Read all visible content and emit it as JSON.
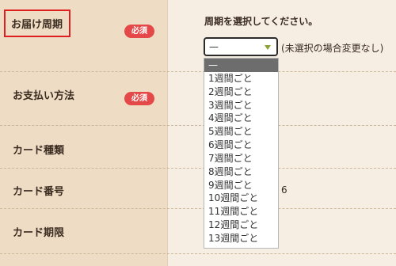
{
  "form": {
    "rows": [
      {
        "label": "お届け周期",
        "required": "必須"
      },
      {
        "label": "お支払い方法",
        "required": "必須"
      },
      {
        "label": "カード種類"
      },
      {
        "label": "カード番号"
      },
      {
        "label": "カード期限"
      }
    ],
    "cycle": {
      "prompt": "周期を選択してください。",
      "selected": "—",
      "note": "(未選択の場合変更なし)",
      "options": [
        "—",
        "1週間ごと",
        "2週間ごと",
        "3週間ごと",
        "4週間ごと",
        "5週間ごと",
        "6週間ごと",
        "7週間ごと",
        "8週間ごと",
        "9週間ごと",
        "10週間ごと",
        "11週間ごと",
        "12週間ごと",
        "13週間ごと"
      ]
    },
    "card_number_fragment": "6"
  },
  "colors": {
    "highlight_border": "#e02020",
    "badge": "#e54848",
    "dropdown_selected": "#6d6d6d"
  }
}
